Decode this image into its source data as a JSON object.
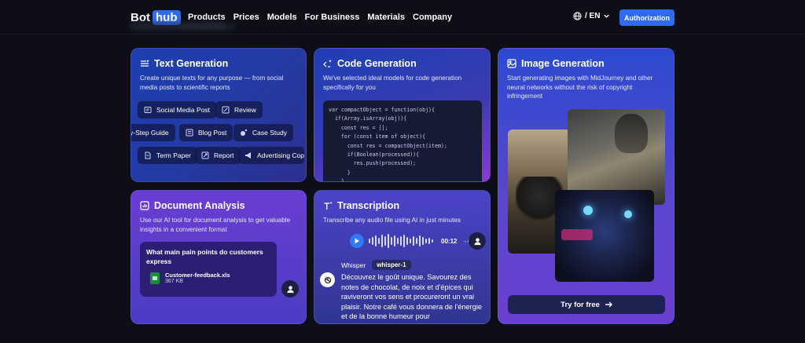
{
  "brand": {
    "bot": "Bot",
    "hub": "hub"
  },
  "nav": [
    "Products",
    "Prices",
    "Models",
    "For Business",
    "Materials",
    "Company"
  ],
  "language": "/ EN",
  "auth_button": "Authorization",
  "text_generation": {
    "title": "Text Generation",
    "description": "Create unique texts for any purpose — from social media posts to scientific reports",
    "chips_row1": [
      "Social Media Post",
      "Review"
    ],
    "chips_row2": [
      "y-Step Guide",
      "Blog Post",
      "Case Study"
    ],
    "chips_row3": [
      "Term Paper",
      "Report",
      "Advertising Cop"
    ]
  },
  "code_generation": {
    "title": "Code Generation",
    "description": "We've selected ideal models for code generation specifically for you",
    "code_lines": [
      "var compactObject = function(obj){",
      "  if(Array.isArray(obj)){",
      "    const res = [];",
      "    for (const item of object){",
      "      const res = compactObject(item);",
      "      if(Boolean(processed)){",
      "        res.push(processed);",
      "      }",
      "    }"
    ]
  },
  "image_generation": {
    "title": "Image Generation",
    "description": "Start generating images with MidJourney and other neural networks without the risk of copyright infringement",
    "cta": "Try for free"
  },
  "document_analysis": {
    "title": "Document Analysis",
    "description": "Use our AI tool for document analysis to get valuable insights in a convenient format",
    "question": "What main pain points do customers express",
    "file_name": "Customer-feedback.xls",
    "file_size": "367 KB"
  },
  "transcription": {
    "title": "Transcription",
    "description": "Transcribe any audio file using AI in just minutes",
    "time": "00:12",
    "to_text": "→A",
    "model_label": "Whisper",
    "model_badge": "whisper-1",
    "text": "Découvrez le goût unique. Savourez des notes de chocolat, de noix et d'épices qui raviveront vos sens et procureront un vrai plaisir. Notre café vous donnera de l'énergie et de la bonne humeur pour"
  },
  "colors": {
    "accent": "#2f6bf2",
    "background": "#0d0e17"
  }
}
